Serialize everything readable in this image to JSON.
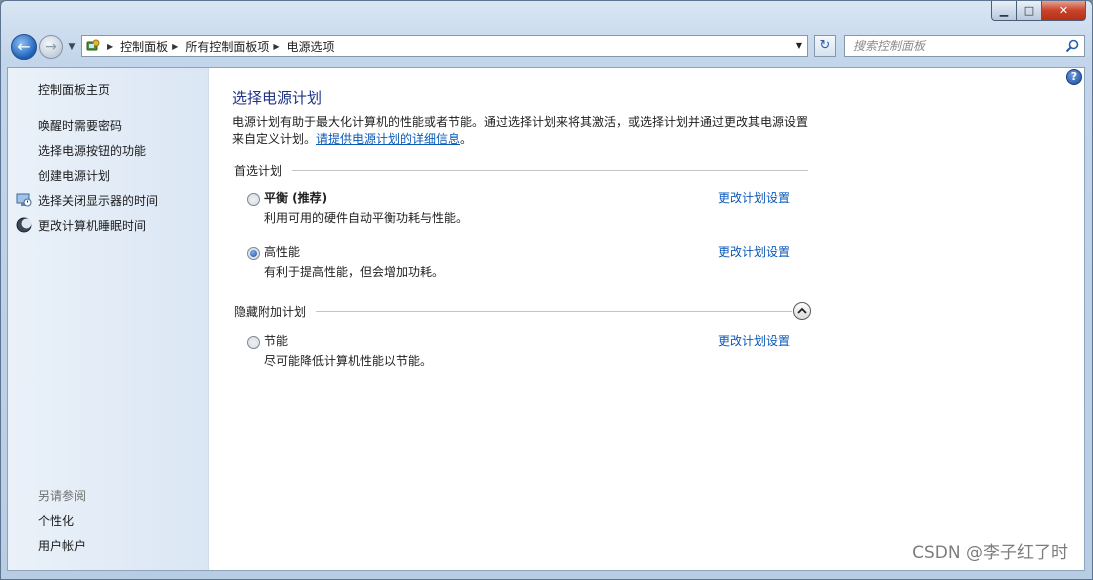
{
  "window": {
    "caption": {
      "minimize": "▁",
      "maximize": "□",
      "close": "✕"
    }
  },
  "nav": {
    "back_glyph": "←",
    "forward_glyph": "→",
    "recent_glyph": "▼",
    "breadcrumbs": [
      "控制面板",
      "所有控制面板项",
      "电源选项"
    ],
    "dropdown_glyph": "▼",
    "refresh_glyph": "↻",
    "search_placeholder": "搜索控制面板"
  },
  "sidebar": {
    "home": "控制面板主页",
    "links": [
      {
        "label": "唤醒时需要密码",
        "icon": ""
      },
      {
        "label": "选择电源按钮的功能",
        "icon": ""
      },
      {
        "label": "创建电源计划",
        "icon": ""
      },
      {
        "label": "选择关闭显示器的时间",
        "icon": "monitor-clock-icon"
      },
      {
        "label": "更改计算机睡眠时间",
        "icon": "moon-icon"
      }
    ],
    "see_also_heading": "另请参阅",
    "see_also": [
      "个性化",
      "用户帐户"
    ]
  },
  "main": {
    "help_glyph": "?",
    "title": "选择电源计划",
    "description_part1": "电源计划有助于最大化计算机的性能或者节能。通过选择计划来将其激活，或选择计划并通过更改其电源设置来自定义计划。",
    "description_link": "请提供电源计划的详细信息",
    "description_end": "。",
    "preferred_group_label": "首选计划",
    "hidden_group_label": "隐藏附加计划",
    "change_link_label": "更改计划设置",
    "plans": [
      {
        "name": "平衡 (推荐)",
        "desc": "利用可用的硬件自动平衡功耗与性能。",
        "selected": false
      },
      {
        "name": "高性能",
        "desc": "有利于提高性能，但会增加功耗。",
        "selected": true
      },
      {
        "name": "节能",
        "desc": "尽可能降低计算机性能以节能。",
        "selected": false
      }
    ]
  },
  "watermark": "CSDN @李子红了时"
}
